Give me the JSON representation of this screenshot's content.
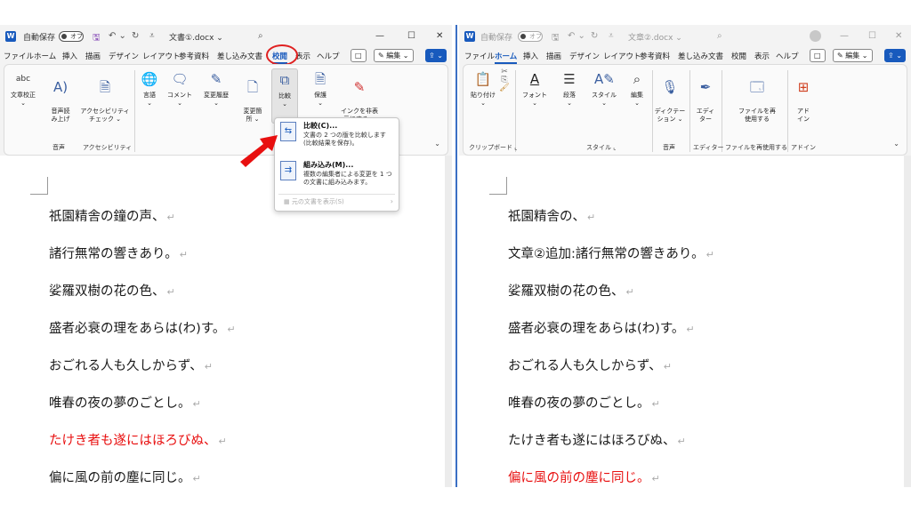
{
  "left": {
    "titlebar": {
      "app_letter": "W",
      "autosave_label": "自動保存",
      "toggle_label": "オフ",
      "doc_title": "文書①.docx",
      "search_icon": "search-icon"
    },
    "menu": [
      "ファイル",
      "ホーム",
      "挿入",
      "描画",
      "デザイン",
      "レイアウト",
      "参考資料",
      "差し込み文書",
      "校閲",
      "表示",
      "ヘルプ"
    ],
    "active_menu": "校閲",
    "comment_btn": "□",
    "edit_btn": "✎ 編集 ⌄",
    "share_btn": "⇪ ⌄",
    "ribbon": {
      "proof_label": "文章校正",
      "abc": "abc",
      "read_aloud": "音声読\nみ上げ",
      "accessibility": "アクセシビリティ\nチェック ⌄",
      "language": "言語",
      "comment": "コメント",
      "track": "変更履歴",
      "changes": "変更箇\n所 ⌄",
      "compare": "比較",
      "protect": "保護",
      "ink": "インクを非表\n示にする ⌄",
      "group_audio": "音声",
      "group_access": "アクセシビリティ"
    },
    "dropdown": {
      "compare_title": "比較(C)...",
      "compare_desc": "文書の 2 つの版を比較します (比較結果を保存)。",
      "combine_title": "組み込み(M)...",
      "combine_desc": "複数の編集者による変更を 1 つの文書に組み込みます。",
      "show_source": "元の文書を表示(S)"
    },
    "lines": [
      {
        "text": "祇園精舎の鐘の声、",
        "red": false
      },
      {
        "text": "諸行無常の響きあり。",
        "red": false
      },
      {
        "text": "娑羅双樹の花の色、",
        "red": false
      },
      {
        "text": "盛者必衰の理をあらは(わ)す。",
        "red": false
      },
      {
        "text": "おごれる人も久しからず、",
        "red": false
      },
      {
        "text": "唯春の夜の夢のごとし。",
        "red": false
      },
      {
        "text": "たけき者も遂にはほろびぬ、",
        "red": true
      },
      {
        "text": "偏に風の前の塵に同じ。",
        "red": false
      }
    ]
  },
  "right": {
    "titlebar": {
      "app_letter": "W",
      "autosave_label": "自動保存",
      "toggle_label": "オフ",
      "doc_title": "文章②.docx"
    },
    "menu": [
      "ファイル",
      "ホーム",
      "挿入",
      "描画",
      "デザイン",
      "レイアウト",
      "参考資料",
      "差し込み文書",
      "校閲",
      "表示",
      "ヘルプ"
    ],
    "active_menu": "ホーム",
    "comment_btn": "□",
    "edit_btn": "✎ 編集 ⌄",
    "share_btn": "⇪ ⌄",
    "ribbon": {
      "paste": "貼り付け",
      "font": "フォント",
      "paragraph": "段落",
      "style": "スタイル",
      "edit": "編集",
      "dictation": "ディクテー\nション ⌄",
      "editor": "エディ\nター",
      "reuse": "ファイルを再\n使用する",
      "addin": "アド\nイン",
      "group_clipboard": "クリップボード ⌞",
      "group_style": "スタイル ⌞",
      "group_audio": "音声",
      "group_editor": "エディター",
      "group_reuse": "ファイルを再使用する",
      "group_addin": "アドイン"
    },
    "lines": [
      {
        "text": "祇園精舎の、",
        "red": false
      },
      {
        "text": "文章②追加:諸行無常の響きあり。",
        "red": false
      },
      {
        "text": "娑羅双樹の花の色、",
        "red": false
      },
      {
        "text": "盛者必衰の理をあらは(わ)す。",
        "red": false
      },
      {
        "text": "おごれる人も久しからず、",
        "red": false
      },
      {
        "text": "唯春の夜の夢のごとし。",
        "red": false
      },
      {
        "text": "たけき者も遂にはほろびぬ、",
        "red": false
      },
      {
        "text": "偏に風の前の塵に同じ。",
        "red": true
      }
    ]
  },
  "paragraph_mark": "↵",
  "colors": {
    "accent": "#185abd",
    "red": "#e81010",
    "divider": "#3b6fc4"
  }
}
